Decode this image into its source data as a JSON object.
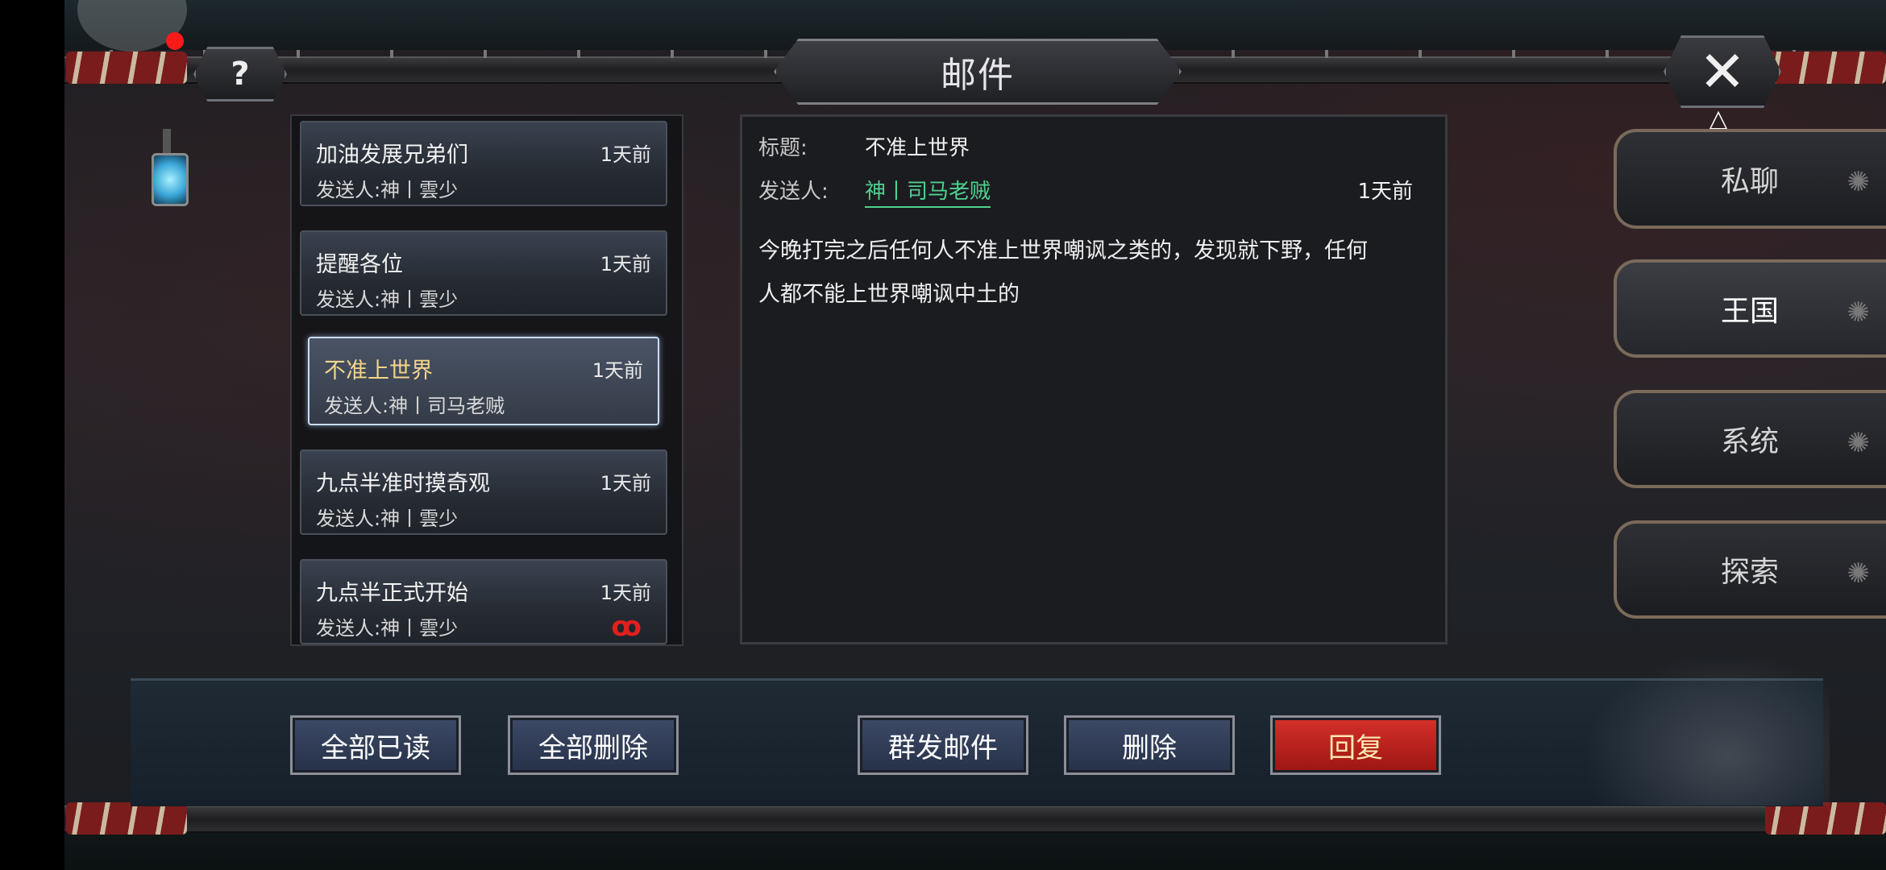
{
  "window": {
    "title": "邮件"
  },
  "header": {
    "help_icon": "question-icon",
    "close_icon": "close-icon"
  },
  "mails": [
    {
      "subject": "加油发展兄弟们",
      "time": "1天前",
      "sender": "发送人:神丨雲少"
    },
    {
      "subject": "提醒各位",
      "time": "1天前",
      "sender": "发送人:神丨雲少"
    },
    {
      "subject": "不准上世界",
      "time": "1天前",
      "sender": "发送人:神丨司马老贼"
    },
    {
      "subject": "九点半准时摸奇观",
      "time": "1天前",
      "sender": "发送人:神丨雲少"
    },
    {
      "subject": "九点半正式开始",
      "time": "1天前",
      "sender": "发送人:神丨雲少"
    }
  ],
  "detail": {
    "subject_label": "标题:",
    "subject": "不准上世界",
    "sender_label": "发送人:",
    "sender": "神丨司马老贼",
    "time": "1天前",
    "body_line1": "今晚打完之后任何人不准上世界嘲讽之类的，发现就下野，任何",
    "body_line2": "人都不能上世界嘲讽中土的"
  },
  "tabs": [
    {
      "label": "私聊",
      "active": false
    },
    {
      "label": "王国",
      "active": true
    },
    {
      "label": "系统",
      "active": false
    },
    {
      "label": "探索",
      "active": false
    }
  ],
  "toolbar": {
    "mark_all_read": "全部已读",
    "delete_all": "全部删除",
    "mass_mail": "群发邮件",
    "delete": "删除",
    "reply": "回复"
  },
  "colors": {
    "accent_green": "#4fd18e",
    "reply_red": "#c4221d",
    "selected_subject": "#f5d58a"
  }
}
